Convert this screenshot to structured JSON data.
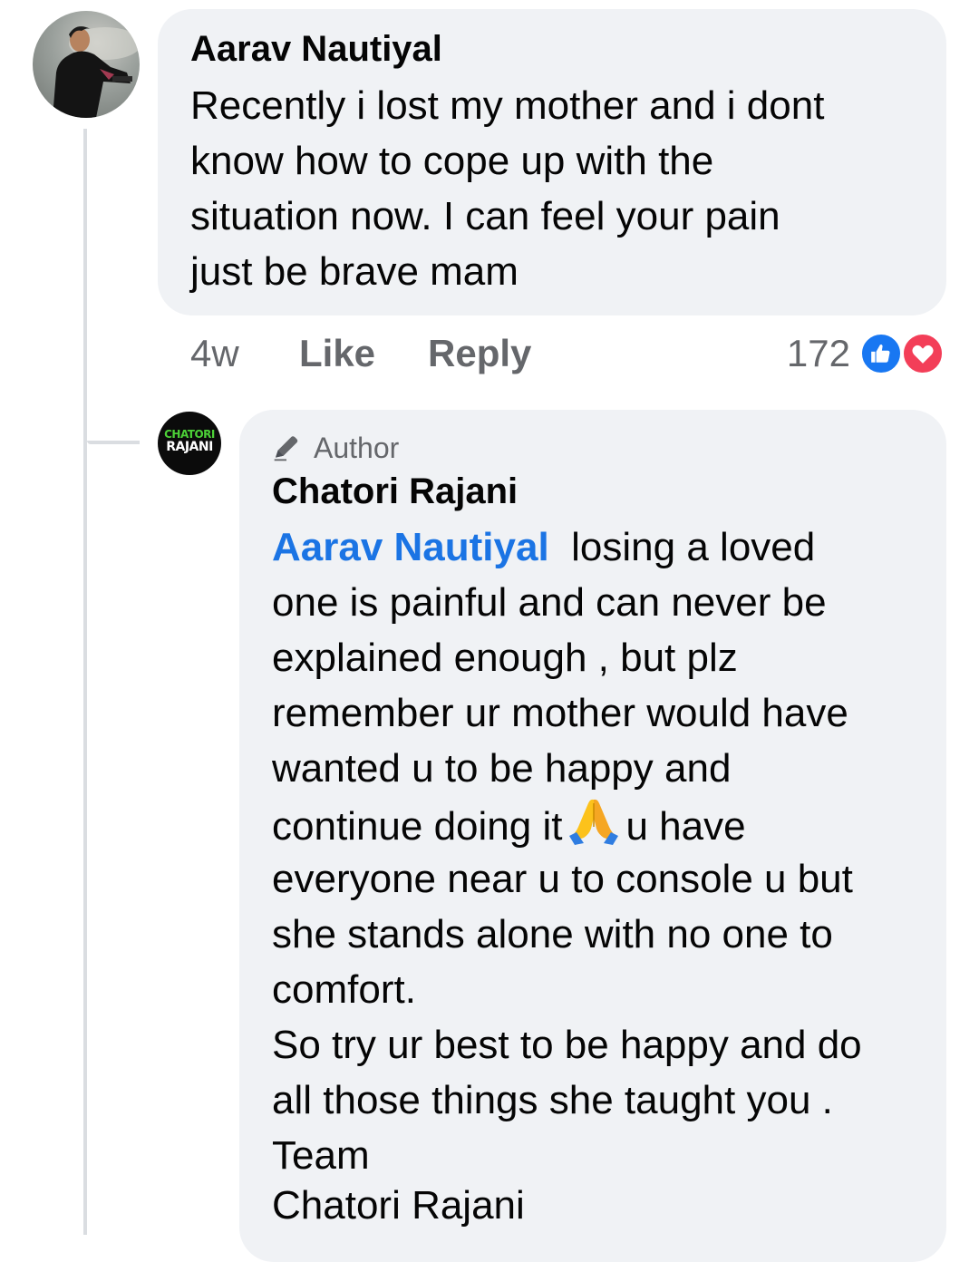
{
  "comment": {
    "author": "Aarav Nautiyal",
    "lines": [
      "Recently i lost my mother and i dont",
      "know how to cope up with the",
      "situation now. I can feel your pain",
      "just be brave mam"
    ],
    "time": "4w",
    "like_label": "Like",
    "reply_label": "Reply",
    "reaction_count": "172",
    "reactions": [
      "like-icon",
      "love-icon"
    ]
  },
  "reply": {
    "badge_icon": "pencil-icon",
    "badge": "Author",
    "author": "Chatori Rajani",
    "avatar_logo": {
      "top": "CHATORI",
      "bottom": "RAJANI"
    },
    "mention": "Aarav Nautiyal",
    "first_line_rest": "losing a loved",
    "lines": [
      "one is painful and can never be",
      "explained enough , but plz",
      "remember ur mother would have",
      "wanted u to be happy and"
    ],
    "emoji_line_before": "continue doing it",
    "emoji": "folded-hands-emoji",
    "emoji_line_after": "u have",
    "lines_after": [
      "everyone near u to console u but",
      "she stands alone with no one to",
      "comfort.",
      "So try ur best to be happy and do",
      "all those things she taught you .",
      "Team",
      "Chatori Rajani"
    ]
  },
  "colors": {
    "bubble": "#f0f2f5",
    "meta": "#65676b",
    "mention": "#1b74e4",
    "like": "#1877f2",
    "love": "#f33e58",
    "thread_line": "#dadde1"
  }
}
